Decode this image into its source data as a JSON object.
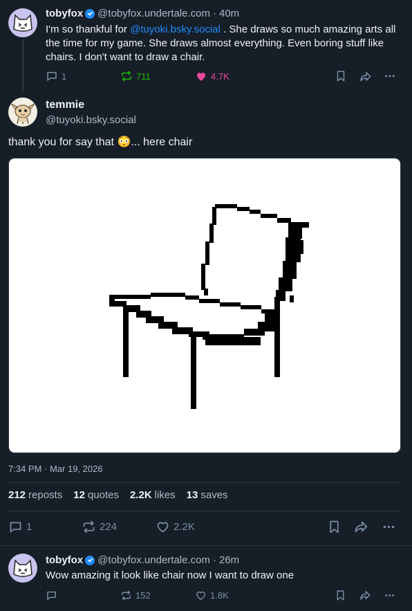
{
  "parent_post": {
    "display_name": "tobyfox",
    "handle": "@tobyfox.undertale.com",
    "time": "40m",
    "text_before": "I'm so thankful for ",
    "mention": "@tuyoki.bsky.social",
    "text_after": " . She draws so much amazing arts all the time for my game. She draws almost everything. Even boring stuff like chairs. I don't want to draw a chair.",
    "replies": "1",
    "reposts": "711",
    "likes": "4.7K"
  },
  "main_post": {
    "display_name": "temmie",
    "handle": "@tuyoki.bsky.social",
    "text": "thank you for say that",
    "text_end": "... here chair",
    "emoji": "😳",
    "timestamp": "7:34 PM · Mar 19, 2026",
    "stats": {
      "reposts_count": "212",
      "reposts_label": "reposts",
      "quotes_count": "12",
      "quotes_label": "quotes",
      "likes_count": "2.2K",
      "likes_label": "likes",
      "saves_count": "13",
      "saves_label": "saves"
    },
    "replies": "1",
    "reposts": "224",
    "likes": "2.2K"
  },
  "reply_post": {
    "display_name": "tobyfox",
    "handle": "@tobyfox.undertale.com",
    "time": "26m",
    "text": "Wow amazing it look like chair now I want to draw one",
    "reposts": "152",
    "likes": "1.8K"
  },
  "colors": {
    "background": "#161e27",
    "accent": "#208bfe",
    "repost_active": "#20bc07",
    "like_active": "#ec4899"
  },
  "icons": [
    "reply-icon",
    "repost-icon",
    "heart-icon",
    "bookmark-icon",
    "share-icon",
    "more-icon",
    "verified-icon"
  ]
}
